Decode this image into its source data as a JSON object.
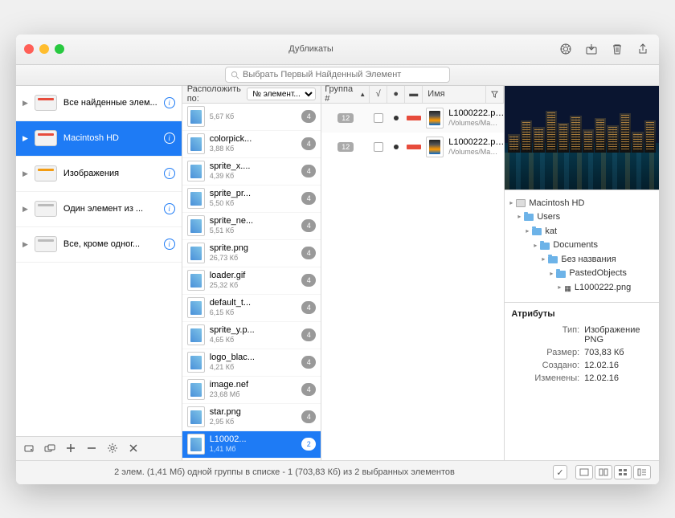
{
  "window": {
    "title": "Дубликаты"
  },
  "search": {
    "placeholder": "Выбрать Первый Найденный Элемент"
  },
  "sidebar": {
    "items": [
      {
        "label": "Все найденные элем...",
        "color": "red"
      },
      {
        "label": "Macintosh HD",
        "color": "red",
        "selected": true
      },
      {
        "label": "Изображения",
        "color": "orange"
      },
      {
        "label": "Один элемент из ...",
        "color": "gray"
      },
      {
        "label": "Все, кроме одног...",
        "color": "gray"
      }
    ]
  },
  "col2": {
    "sort_label": "Расположить по:",
    "sort_value": "№ элемент...",
    "files": [
      {
        "name": "",
        "size": "5,67 Кб",
        "badge": "4"
      },
      {
        "name": "colorpick...",
        "size": "3,88 Кб",
        "badge": "4"
      },
      {
        "name": "sprite_x....",
        "size": "4,39 Кб",
        "badge": "4"
      },
      {
        "name": "sprite_pr...",
        "size": "5,50 Кб",
        "badge": "4"
      },
      {
        "name": "sprite_ne...",
        "size": "5,51 Кб",
        "badge": "4"
      },
      {
        "name": "sprite.png",
        "size": "26,73 Кб",
        "badge": "4"
      },
      {
        "name": "loader.gif",
        "size": "25,32 Кб",
        "badge": "4"
      },
      {
        "name": "default_t...",
        "size": "6,15 Кб",
        "badge": "4"
      },
      {
        "name": "sprite_y.p...",
        "size": "4,65 Кб",
        "badge": "4"
      },
      {
        "name": "logo_blac...",
        "size": "4,21 Кб",
        "badge": "4"
      },
      {
        "name": "image.nef",
        "size": "23,68 Мб",
        "badge": "4"
      },
      {
        "name": "star.png",
        "size": "2,95 Кб",
        "badge": "4"
      },
      {
        "name": "L10002...",
        "size": "1,41 Мб",
        "badge": "2",
        "selected": true
      }
    ]
  },
  "col3": {
    "headers": {
      "group": "Группа #",
      "name": "Имя"
    },
    "rows": [
      {
        "group": "12",
        "name": "L1000222.p…",
        "path": "/Volumes/Ma…"
      },
      {
        "group": "12",
        "name": "L1000222.p…",
        "path": "/Volumes/Ma…"
      }
    ]
  },
  "pathtree": [
    {
      "indent": 0,
      "icon": "hdd",
      "label": "Macintosh HD"
    },
    {
      "indent": 1,
      "icon": "fld",
      "label": "Users"
    },
    {
      "indent": 2,
      "icon": "fld",
      "label": "kat"
    },
    {
      "indent": 3,
      "icon": "fld",
      "label": "Documents"
    },
    {
      "indent": 4,
      "icon": "fld",
      "label": "Без названия"
    },
    {
      "indent": 5,
      "icon": "fld",
      "label": "PastedObjects"
    },
    {
      "indent": 6,
      "icon": "img",
      "label": "L1000222.png"
    }
  ],
  "attrs": {
    "title": "Атрибуты",
    "rows": [
      {
        "k": "Тип:",
        "v": "Изображение PNG"
      },
      {
        "k": "Размер:",
        "v": "703,83 Кб"
      },
      {
        "k": "Создано:",
        "v": "12.02.16"
      },
      {
        "k": "Изменены:",
        "v": "12.02.16"
      }
    ]
  },
  "status": "2 элем. (1,41 Мб) одной группы в списке - 1 (703,83 Кб) из 2 выбранных элементов"
}
